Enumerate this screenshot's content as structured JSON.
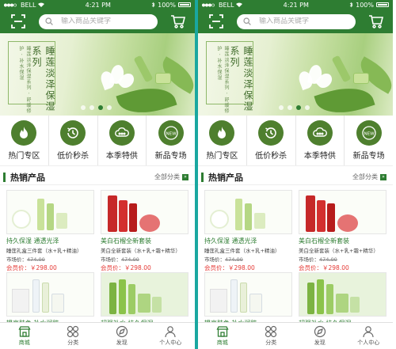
{
  "colors": {
    "primary": "#2e7d32",
    "price": "#e53935",
    "divider": "#1aa7a0"
  },
  "status_bar": {
    "carrier": "BELL",
    "time": "4:21 PM",
    "battery": "100%"
  },
  "header": {
    "scan_icon": "scan-icon",
    "search_placeholder": "输入商品关键字",
    "cart_icon": "cart-icon"
  },
  "banner": {
    "title": "睡莲淡泽保湿系列",
    "subtitle": "睡莲淡泽保湿系列 · 舒缓修护 · 补水保湿",
    "slides": 4,
    "active_slide": 0
  },
  "categories": [
    {
      "label": "热门专区",
      "icon": "fire-icon"
    },
    {
      "label": "低价秒杀",
      "icon": "clock-icon"
    },
    {
      "label": "本季特供",
      "icon": "cloud-icon"
    },
    {
      "label": "新品专场",
      "icon": "new-badge-icon"
    }
  ],
  "section": {
    "title": "热销产品",
    "more_label": "全部分类",
    "more_arrow": "»"
  },
  "products": [
    {
      "name": "持久保湿 通透光泽",
      "desc": "睡莲礼盒三件套（水+乳+精油）",
      "market_label": "市场价：",
      "market_price": "474.00",
      "member_label": "会员价：",
      "member_price": "￥298.00",
      "theme": "green"
    },
    {
      "name": "美白石榴全新套装",
      "desc": "美白全新套装（水+乳+霜+精华）",
      "market_label": "市场价：",
      "market_price": "474.00",
      "member_label": "会员价：",
      "member_price": "￥298.00",
      "theme": "red"
    },
    {
      "name": "提亮肤色 补水润肤",
      "theme": "white"
    },
    {
      "name": "超强补水 持久保湿",
      "theme": "greenset"
    }
  ],
  "tabs": [
    {
      "label": "商城",
      "icon": "shop-icon",
      "active": true
    },
    {
      "label": "分类",
      "icon": "grid-icon",
      "active": false
    },
    {
      "label": "发现",
      "icon": "discover-icon",
      "active": false
    },
    {
      "label": "个人中心",
      "icon": "user-icon",
      "active": false
    }
  ]
}
